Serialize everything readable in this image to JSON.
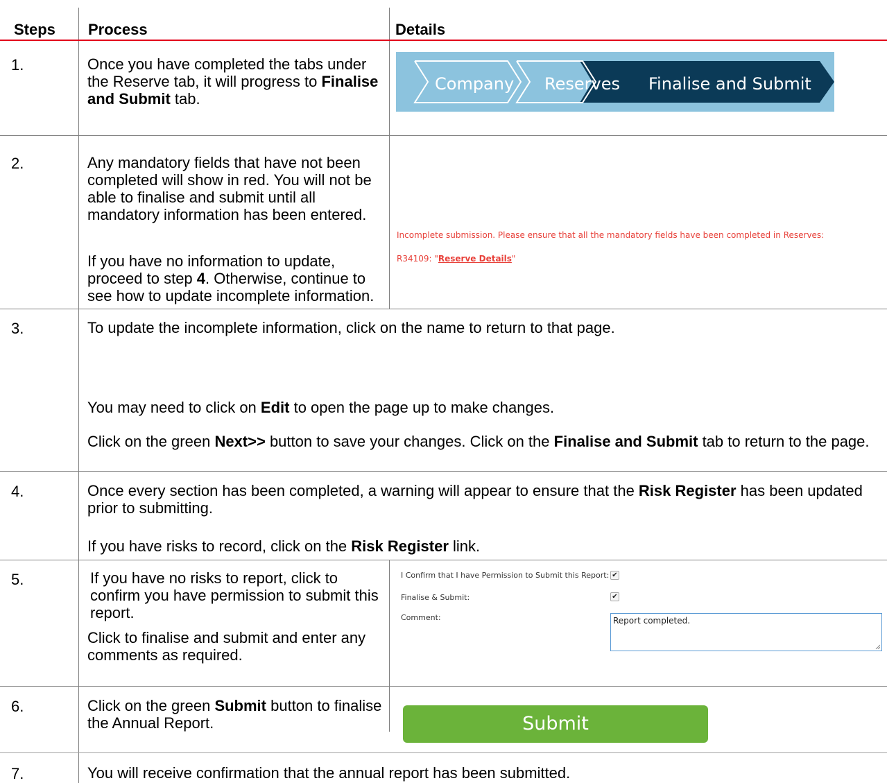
{
  "header": {
    "steps": "Steps",
    "process": "Process",
    "details": "Details"
  },
  "steps": [
    {
      "num": "1.",
      "p1": "Once you have completed the tabs under the Reserve tab, it will progress to ",
      "b1": "Finalise and Submit",
      "p2": " tab."
    },
    {
      "num": "2.",
      "para1": "Any mandatory fields that have not been completed will show in red. You will not be able to finalise and submit until all mandatory information has been entered.",
      "p1": "If you have no information to update, proceed to step ",
      "b1": "4",
      "p2": ". Otherwise, continue to see how to update incomplete information."
    },
    {
      "num": "3.",
      "line1": "To update the incomplete information, click on the name to return to that page.",
      "l2a": "You may need to click on ",
      "l2b": "Edit",
      "l2c": " to open the page up to make changes.",
      "l3a": "Click on the green ",
      "l3b": "Next>>",
      "l3c": " button to save your changes. Click on the ",
      "l3d": "Finalise and Submit",
      "l3e": " tab to return to the page."
    },
    {
      "num": "4.",
      "l1a": "Once every section has been completed, a warning will appear to ensure that the ",
      "l1b": "Risk Register",
      "l1c": " has been updated prior to submitting.",
      "l2a": "If you have risks to record, click on the ",
      "l2b": "Risk Register",
      "l2c": " link."
    },
    {
      "num": "5.",
      "para1": "If you have no risks to report, click to confirm you have permission to submit this report.",
      "para2": "Click to finalise and submit and enter any comments as required."
    },
    {
      "num": "6.",
      "p1": "Click on the green ",
      "b1": "Submit",
      "p2": " button to finalise the Annual Report."
    },
    {
      "num": "7.",
      "text": "You will receive confirmation that the annual report has been submitted."
    }
  ],
  "breadcrumb": {
    "items": [
      "Company",
      "Reserves",
      "Finalise and Submit"
    ]
  },
  "error_message": {
    "text": "Incomplete submission. Please ensure that all the mandatory fields have been completed in Reserves:",
    "code": "R34109: \"",
    "link": "Reserve Details",
    "close": "\""
  },
  "form": {
    "confirm_label": "I Confirm that I have Permission to Submit this Report:",
    "finalise_label": "Finalise & Submit:",
    "comment_label": "Comment:",
    "comment_value": "Report completed.",
    "confirm_checked": true,
    "finalise_checked": true
  },
  "submit_button": {
    "label": "Submit"
  },
  "colors": {
    "header_rule": "#e2001a",
    "error_red": "#e8413a",
    "submit_green": "#6bb33a",
    "breadcrumb_bg": "#8cc3de",
    "breadcrumb_active": "#0b3a57"
  }
}
